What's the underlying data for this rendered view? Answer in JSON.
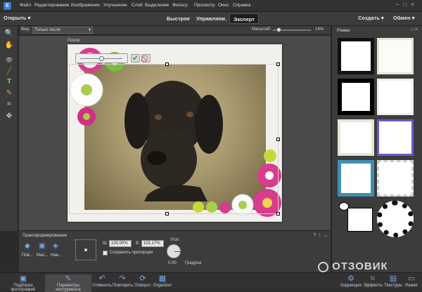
{
  "menubar": {
    "logo": "E",
    "items": [
      "Файл",
      "Редактирование",
      "Изображение",
      "Улучшение",
      "Слой",
      "Выделение",
      "Фильтр",
      "Просмотр",
      "Окно",
      "Справка"
    ],
    "win_controls": "–□×"
  },
  "toolbar": {
    "open_label": "Открыть",
    "modes": [
      "Быстрое",
      "Управляем.",
      "Эксперт"
    ],
    "active_mode": "Эксперт",
    "create_label": "Создать",
    "share_label": "Обмен"
  },
  "options": {
    "view_label": "Вид:",
    "view_value": "Только после",
    "zoom_label": "Масштаб:",
    "zoom_value": "14%",
    "zoom_level": 0.14,
    "after_label": "После"
  },
  "tools": {
    "icons": [
      "zoom-icon",
      "hand-icon",
      "eye-icon",
      "brush-icon",
      "text-icon",
      "eraser-icon",
      "crop-icon",
      "move-icon"
    ],
    "glyphs": [
      "🔍",
      "✋",
      "👁",
      "╱",
      "T",
      "✎",
      "⌗",
      "✥"
    ]
  },
  "canvas_controls": {
    "commit": "✔",
    "cancel": "⃠"
  },
  "transform_panel": {
    "title": "Трансформирование",
    "buttons": [
      "Пов...",
      "Мас...",
      "Наи..."
    ],
    "w_label": "Ш:",
    "w_value": "100,00%",
    "h_label": "В:",
    "h_value": "102,17%",
    "keep_proportions": "Сохранить пропорции",
    "angle_label": "Угол",
    "angle_value": "0,00",
    "degrees_label": "Градусы"
  },
  "right_panel": {
    "title": "Рамки"
  },
  "taskbar": {
    "items": [
      {
        "label": "Подборка фотографий",
        "icon": "photo-bin-icon",
        "glyph": "▣"
      },
      {
        "label": "Параметры инструмента",
        "icon": "tool-options-icon",
        "glyph": "✎"
      },
      {
        "label": "Отменить",
        "icon": "undo-icon",
        "glyph": "↶"
      },
      {
        "label": "Повторить",
        "icon": "redo-icon",
        "glyph": "↷"
      },
      {
        "label": "Поворот",
        "icon": "rotate-icon",
        "glyph": "⟳"
      },
      {
        "label": "Organizer",
        "icon": "organizer-icon",
        "glyph": "▦"
      }
    ],
    "right_items": [
      {
        "label": "Коррекция",
        "icon": "correction-icon",
        "glyph": "⚙"
      },
      {
        "label": "Эффекты",
        "icon": "effects-icon",
        "glyph": "fx"
      },
      {
        "label": "Текстуры",
        "icon": "textures-icon",
        "glyph": "▤"
      },
      {
        "label": "Рамки",
        "icon": "frames-icon",
        "glyph": "▭"
      }
    ]
  },
  "watermark": "ОТЗОВИК"
}
